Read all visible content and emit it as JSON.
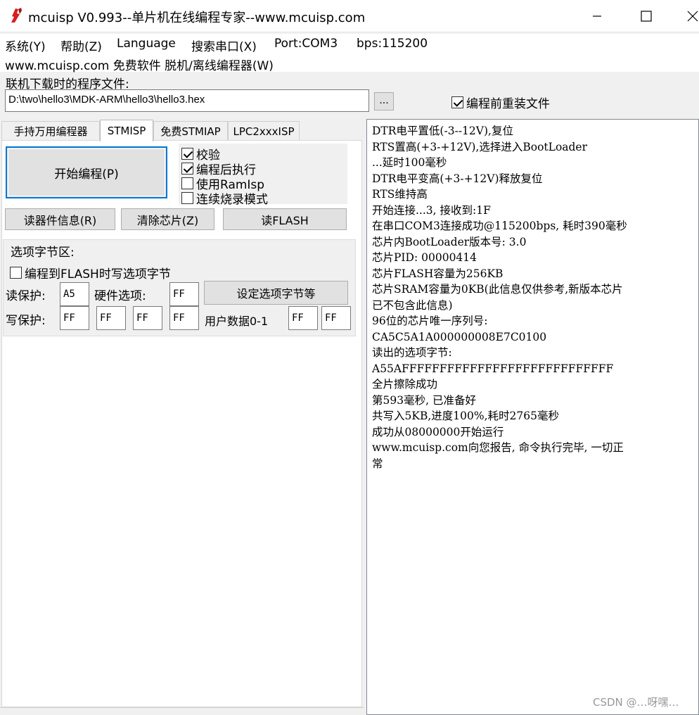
{
  "window": {
    "title": "mcuisp V0.993--单片机在线编程专家--www.mcuisp.com",
    "icon": "mcuisp-app-icon"
  },
  "menu": {
    "system": "系统(Y)",
    "help": "帮助(Z)",
    "language": "Language",
    "search_port": "搜索串口(X)",
    "port": "Port:COM3",
    "bps": "bps:115200",
    "website": "www.mcuisp.com 免费软件 脱机/离线编程器(W)"
  },
  "file": {
    "label": "联机下载时的程序文件:",
    "path": "D:\\two\\hello3\\MDK-ARM\\hello3\\hello3.hex",
    "browse_label": "...",
    "reload_label": "编程前重装文件",
    "reload_checked": true
  },
  "tabs": [
    "手持万用编程器",
    "STMISP",
    "免费STMIAP",
    "LPC2xxxISP"
  ],
  "active_tab": "STMISP",
  "stmisp": {
    "start_button": "开始编程(P)",
    "options": [
      {
        "label": "校验",
        "checked": true
      },
      {
        "label": "编程后执行",
        "checked": true
      },
      {
        "label": "使用RamIsp",
        "checked": false
      },
      {
        "label": "连续烧录模式",
        "checked": false
      }
    ],
    "read_info_button": "读器件信息(R)",
    "erase_button": "清除芯片(Z)",
    "read_flash_button": "读FLASH"
  },
  "option_bytes": {
    "group_title": "选项字节区:",
    "program_option_label": "编程到FLASH时写选项字节",
    "program_option_checked": false,
    "read_protect_label": "读保护:",
    "read_protect_value": "A5",
    "hardware_label": "硬件选项:",
    "hardware_value": "FF",
    "set_button": "设定选项字节等",
    "write_protect_label": "写保护:",
    "write_protect_values": [
      "FF",
      "FF",
      "FF",
      "FF"
    ],
    "user_data_label": "用户数据0-1",
    "user_data_values": [
      "FF",
      "FF"
    ]
  },
  "log": [
    "DTR电平置低(-3--12V),复位",
    "RTS置高(+3-+12V),选择进入BootLoader",
    "...延时100毫秒",
    "DTR电平变高(+3-+12V)释放复位",
    "RTS维持高",
    "开始连接...3, 接收到:1F",
    "在串口COM3连接成功@115200bps, 耗时390毫秒",
    "芯片内BootLoader版本号: 3.0",
    "芯片PID: 00000414",
    "芯片FLASH容量为256KB",
    "芯片SRAM容量为0KB(此信息仅供参考,新版本芯片",
    "已不包含此信息)",
    "96位的芯片唯一序列号:",
    "CA5C5A1A000000008E7C0100",
    "读出的选项字节:",
    "A55AFFFFFFFFFFFFFFFFFFFFFFFFFFFF",
    "全片擦除成功",
    "第593毫秒, 已准备好",
    "共写入5KB,进度100%,耗时2765毫秒",
    "成功从08000000开始运行",
    "www.mcuisp.com向您报告, 命令执行完毕, 一切正",
    "常"
  ],
  "watermark": "CSDN @…呀嘿…"
}
